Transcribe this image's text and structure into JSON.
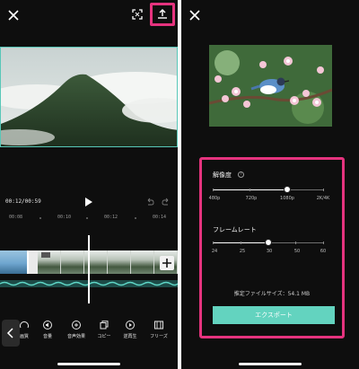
{
  "left_screen": {
    "timecode": "00:12/00:59",
    "ruler_labels": [
      "00:08",
      "00:10",
      "00:12",
      "00:14"
    ],
    "toolbar_items": [
      {
        "label": "画質",
        "icon": "speed-gauge-icon"
      },
      {
        "label": "音量",
        "icon": "volume-icon"
      },
      {
        "label": "音声効果",
        "icon": "voice-effect-icon"
      },
      {
        "label": "コピー",
        "icon": "copy-icon"
      },
      {
        "label": "逆再生",
        "icon": "reverse-play-icon"
      },
      {
        "label": "フリーズ",
        "icon": "freeze-icon"
      }
    ]
  },
  "right_screen": {
    "resolution": {
      "title": "解像度",
      "options": [
        "480p",
        "720p",
        "1080p",
        "2K/4K"
      ],
      "selected": "1080p"
    },
    "frame_rate": {
      "title": "フレームレート",
      "options": [
        "24",
        "25",
        "30",
        "50",
        "60"
      ],
      "selected": "30"
    },
    "estimated_size_label": "推定ファイルサイズ：54.1 MB",
    "export_button_label": "エクスポート"
  },
  "colors": {
    "highlight_border": "#e5337e",
    "accent_teal": "#63d3bf",
    "background": "#0e0e0e"
  }
}
